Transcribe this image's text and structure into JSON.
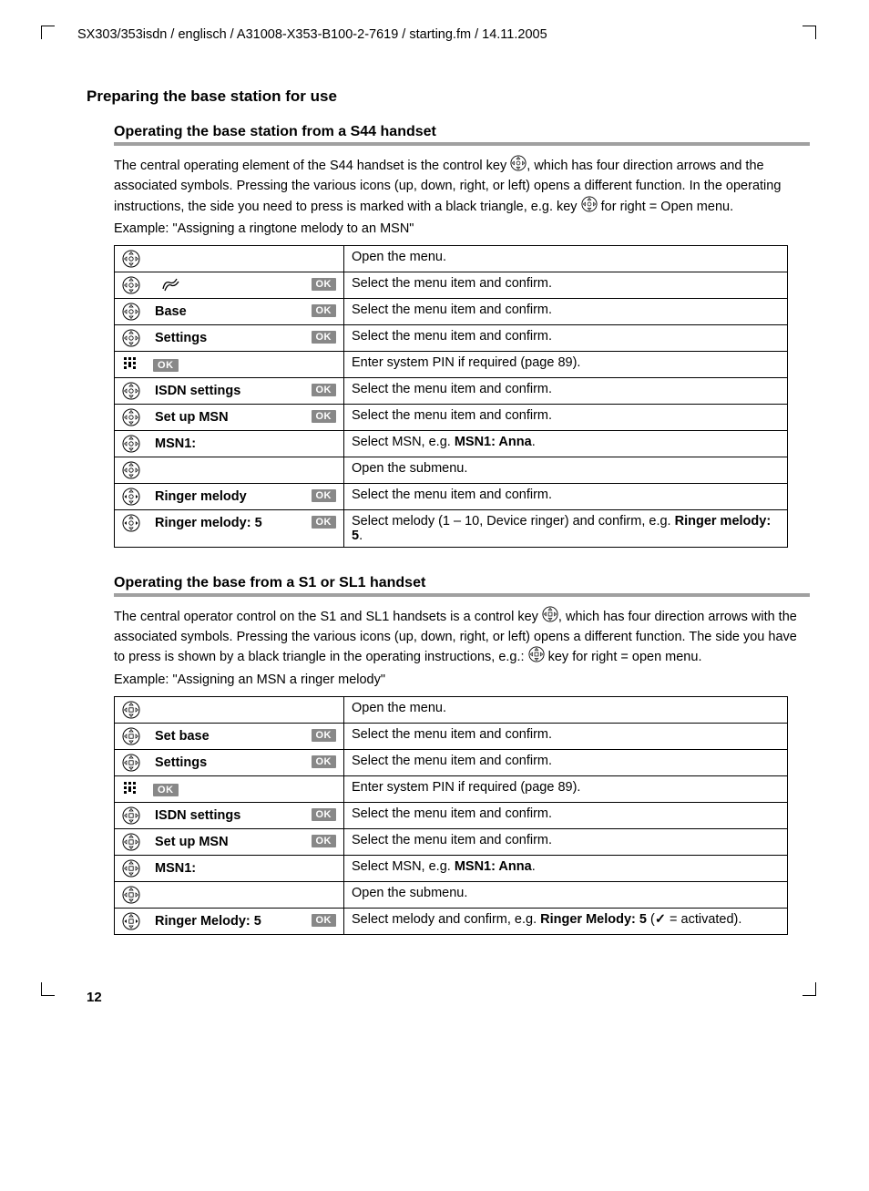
{
  "header": "SX303/353isdn / englisch / A31008-X353-B100-2-7619 / starting.fm / 14.11.2005",
  "section_title": "Preparing the base station for use",
  "sub1": {
    "title": "Operating the base station from a S44 handset",
    "body_pre": "The central operating element of the S44 handset is the control key ",
    "body_post": ", which has four direction arrows and the associated symbols. Pressing the various icons (up, down, right, or left) opens a different function. In the operating instructions, the side you need to press is marked with a black triangle, e.g. key ",
    "body_tail": " for right = Open menu.",
    "example": "Example: \"Assigning a ringtone melody to an MSN\"",
    "rows": [
      {
        "icon": "nav",
        "label": "",
        "ok": false,
        "desc_plain": "Open the menu."
      },
      {
        "icon": "nav",
        "label_icon": "sound",
        "ok": true,
        "desc_plain": "Select the menu item and confirm."
      },
      {
        "icon": "nav",
        "label": "Base",
        "ok": true,
        "desc_plain": "Select the menu item and confirm."
      },
      {
        "icon": "nav",
        "label": "Settings",
        "ok": true,
        "desc_plain": "Select the menu item and confirm."
      },
      {
        "icon": "keypad",
        "ok_left": true,
        "desc_plain": "Enter system PIN if required (page 89)."
      },
      {
        "icon": "nav",
        "label": "ISDN settings",
        "ok": true,
        "desc_plain": "Select the menu item and confirm."
      },
      {
        "icon": "nav",
        "label": "Set up MSN",
        "ok": true,
        "desc_plain": "Select the menu item and confirm."
      },
      {
        "icon": "nav",
        "label": "MSN1:",
        "ok": false,
        "desc_pre": "Select MSN, e.g. ",
        "desc_bold": "MSN1: Anna",
        "desc_post": "."
      },
      {
        "icon": "nav",
        "label": "",
        "ok": false,
        "desc_plain": "Open the submenu."
      },
      {
        "icon": "nav-lr",
        "label": "Ringer melody",
        "ok": true,
        "desc_plain": "Select the menu item and confirm."
      },
      {
        "icon": "nav-lr",
        "label": "Ringer melody: 5",
        "ok": true,
        "desc_pre": "Select melody (1 – 10, Device ringer) and confirm, e.g. ",
        "desc_bold": "Ringer melody: 5",
        "desc_post": "."
      }
    ]
  },
  "sub2": {
    "title": "Operating the base from a S1 or SL1 handset",
    "body_pre": "The central operator control on the S1 and SL1 handsets is a control key ",
    "body_post": ", which has four direction arrows with the associated symbols. Pressing the various icons (up, down, right, or left) opens a different function. The side you have to press is shown by a black triangle in the operating instructions, e.g.: ",
    "body_tail": " key for right = open menu.",
    "example": "Example: \"Assigning an MSN a ringer melody\"",
    "rows": [
      {
        "icon": "nav2",
        "label": "",
        "ok": false,
        "desc_plain": "Open the menu."
      },
      {
        "icon": "nav2",
        "label": "Set base",
        "ok": true,
        "desc_plain": "Select the menu item and confirm."
      },
      {
        "icon": "nav2",
        "label": "Settings",
        "ok": true,
        "desc_plain": "Select the menu item and confirm."
      },
      {
        "icon": "keypad",
        "ok_left": true,
        "desc_plain": "Enter system PIN if required (page 89)."
      },
      {
        "icon": "nav2",
        "label": "ISDN settings",
        "ok": true,
        "desc_plain": "Select the menu item and confirm."
      },
      {
        "icon": "nav2",
        "label": "Set up MSN",
        "ok": true,
        "desc_plain": "Select the menu item and confirm."
      },
      {
        "icon": "nav2",
        "label": "MSN1:",
        "ok": false,
        "desc_pre": "Select MSN, e.g. ",
        "desc_bold": "MSN1: Anna",
        "desc_post": "."
      },
      {
        "icon": "nav2",
        "label": "",
        "ok": false,
        "desc_plain": "Open the submenu."
      },
      {
        "icon": "nav2-lr",
        "label": "Ringer Melody: 5",
        "ok": true,
        "desc_pre": "Select melody and confirm, e.g. ",
        "desc_bold": "Ringer Melody: 5",
        "desc_post_check": " = activated)."
      }
    ]
  },
  "ok_label": "OK",
  "page_number": "12"
}
